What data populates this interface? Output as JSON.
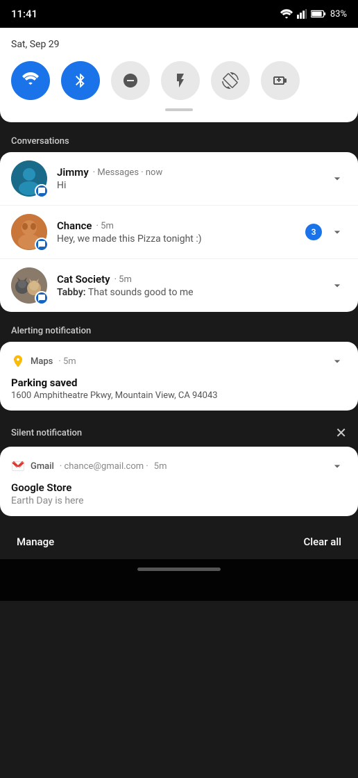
{
  "statusBar": {
    "time": "11:41",
    "battery": "83%"
  },
  "quickSettings": {
    "date": "Sat, Sep 29",
    "tiles": [
      {
        "id": "wifi",
        "label": "Wi-Fi",
        "active": true
      },
      {
        "id": "bluetooth",
        "label": "Bluetooth",
        "active": true
      },
      {
        "id": "dnd",
        "label": "Do Not Disturb",
        "active": false
      },
      {
        "id": "flashlight",
        "label": "Flashlight",
        "active": false
      },
      {
        "id": "rotate",
        "label": "Auto Rotate",
        "active": false
      },
      {
        "id": "battery-saver",
        "label": "Battery Saver",
        "active": false
      }
    ]
  },
  "sections": {
    "conversations": "Conversations",
    "alerting": "Alerting notification",
    "silent": "Silent notification"
  },
  "conversations": [
    {
      "name": "Jimmy",
      "app": "Messages",
      "time": "now",
      "preview": "Hi",
      "badge": null,
      "avatarType": "jimmy"
    },
    {
      "name": "Chance",
      "app": "",
      "time": "5m",
      "preview": "Hey, we made this Pizza tonight :)",
      "badge": "3",
      "avatarType": "chance"
    },
    {
      "name": "Cat Society",
      "app": "",
      "time": "5m",
      "previewBold": "Tabby:",
      "preview": " That sounds good to me",
      "badge": null,
      "avatarType": "cat"
    }
  ],
  "alertingNotification": {
    "app": "Maps",
    "time": "5m",
    "title": "Parking saved",
    "body": "1600 Amphitheatre Pkwy, Mountain View, CA 94043"
  },
  "silentNotification": {
    "app": "Gmail",
    "email": "chance@gmail.com",
    "time": "5m",
    "title": "Google Store",
    "body": "Earth Day is here"
  },
  "bottomBar": {
    "manage": "Manage",
    "clearAll": "Clear all"
  }
}
